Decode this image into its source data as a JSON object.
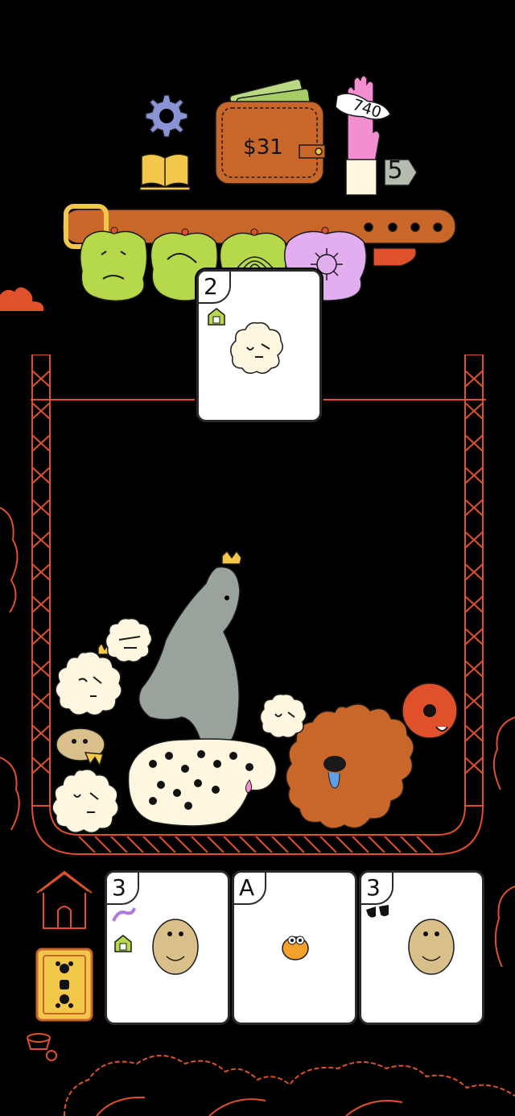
{
  "hud": {
    "money": "$31",
    "score": "740",
    "hand_count": "5",
    "settings_icon": "gear-icon",
    "rules_icon": "book-icon"
  },
  "belt": {
    "charms": [
      "green-blob-face-charm",
      "green-blob-charm",
      "green-shell-charm",
      "purple-virus-charm"
    ]
  },
  "active_card": {
    "rank": "2",
    "suit_icon": "doghouse-icon",
    "creature": "white-fluffy-dog"
  },
  "hand": {
    "cards": [
      {
        "rank": "3",
        "creature": "pug",
        "modifiers": [
          "worm-icon",
          "doghouse-icon"
        ]
      },
      {
        "rank": "A",
        "creature": "orange-fish"
      },
      {
        "rank": "3",
        "creature": "pug",
        "modifiers": [
          "sunglasses-icon"
        ]
      }
    ]
  },
  "colors": {
    "background": "#000000",
    "accent_orange": "#e0502b",
    "card": "#ffffff",
    "green": "#b5d94a",
    "purple": "#e2aef0"
  }
}
